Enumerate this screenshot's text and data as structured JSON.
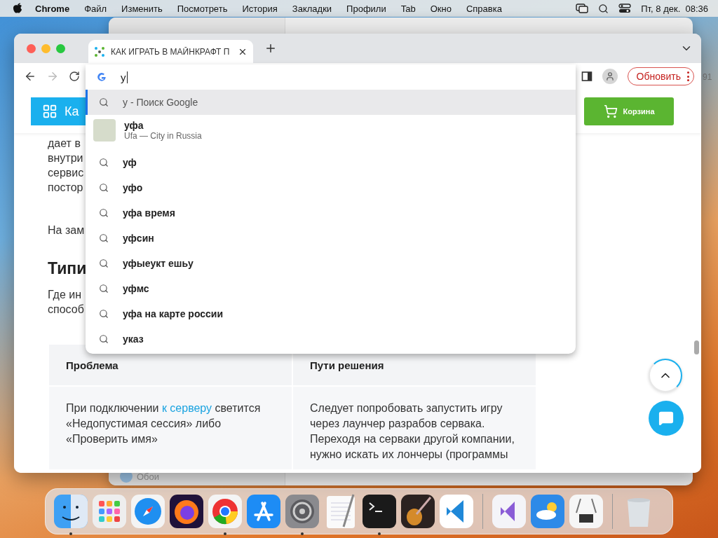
{
  "menu_bar": {
    "app": "Chrome",
    "items": [
      "Файл",
      "Изменить",
      "Посмотреть",
      "История",
      "Закладки",
      "Профили",
      "Tab",
      "Окно",
      "Справка"
    ],
    "clock": "Пт, 8 дек.  08:36"
  },
  "back_window": {
    "sidebar_item": "Обои",
    "edge_text": "91"
  },
  "browser": {
    "tab": {
      "title": "КАК ИГРАТЬ В МАЙНКРАФТ П",
      "selected": true
    },
    "omnibox": {
      "value": "у"
    },
    "forward_disabled": true,
    "update_button": "Обновить",
    "suggestions": [
      {
        "kind": "search",
        "text": "у",
        "suffix": "- Поиск Google",
        "selected": true
      },
      {
        "kind": "entity",
        "text": "уфа",
        "subtitle": "Ufa — City in Russia",
        "selected": false
      },
      {
        "kind": "search",
        "text": "уф",
        "selected": false
      },
      {
        "kind": "search",
        "text": "уфо",
        "selected": false
      },
      {
        "kind": "search",
        "text": "уфа время",
        "selected": false
      },
      {
        "kind": "search",
        "text": "уфсин",
        "selected": false
      },
      {
        "kind": "search",
        "text": "уфыеукт ешьу",
        "selected": false
      },
      {
        "kind": "search",
        "text": "уфмс",
        "selected": false
      },
      {
        "kind": "search",
        "text": "уфа на карте россии",
        "selected": false
      },
      {
        "kind": "search",
        "text": "указ",
        "selected": false
      }
    ]
  },
  "page": {
    "catalog_button": "Ка",
    "cart_button": "Корзина",
    "lines_top": [
      "дает в",
      "внутри",
      "сервис",
      "постор"
    ],
    "line_mid": "На зам",
    "heading": "Типи",
    "lines_bottom": [
      "Где ин",
      "способ"
    ],
    "table": {
      "columns": [
        "Проблема",
        "Пути решения"
      ],
      "rows": [
        {
          "problem": [
            "При подключении ",
            "к серверу",
            " светится «Недопустимая сессия» либо «Проверить имя»"
          ],
          "solution": "Следует попробовать запустить игру через лаунчер разрабов сервака. Переходя на серваки другой компании, нужно искать их лончеры (программы"
        }
      ]
    }
  },
  "dock": [
    {
      "kind": "finder",
      "running": true
    },
    {
      "kind": "launchpad",
      "running": false
    },
    {
      "kind": "safari",
      "running": false
    },
    {
      "kind": "firefox",
      "running": false
    },
    {
      "kind": "chrome",
      "running": true
    },
    {
      "kind": "appstore",
      "running": false
    },
    {
      "kind": "settings",
      "running": true
    },
    {
      "kind": "textedit",
      "running": false
    },
    {
      "kind": "terminal",
      "running": true
    },
    {
      "kind": "guitar",
      "running": false
    },
    {
      "kind": "vscode",
      "running": false
    },
    {
      "kind": "separator"
    },
    {
      "kind": "visualstudio",
      "running": false
    },
    {
      "kind": "weather",
      "running": false
    },
    {
      "kind": "sysinfo",
      "running": false
    },
    {
      "kind": "separator"
    },
    {
      "kind": "trash",
      "running": false
    }
  ]
}
